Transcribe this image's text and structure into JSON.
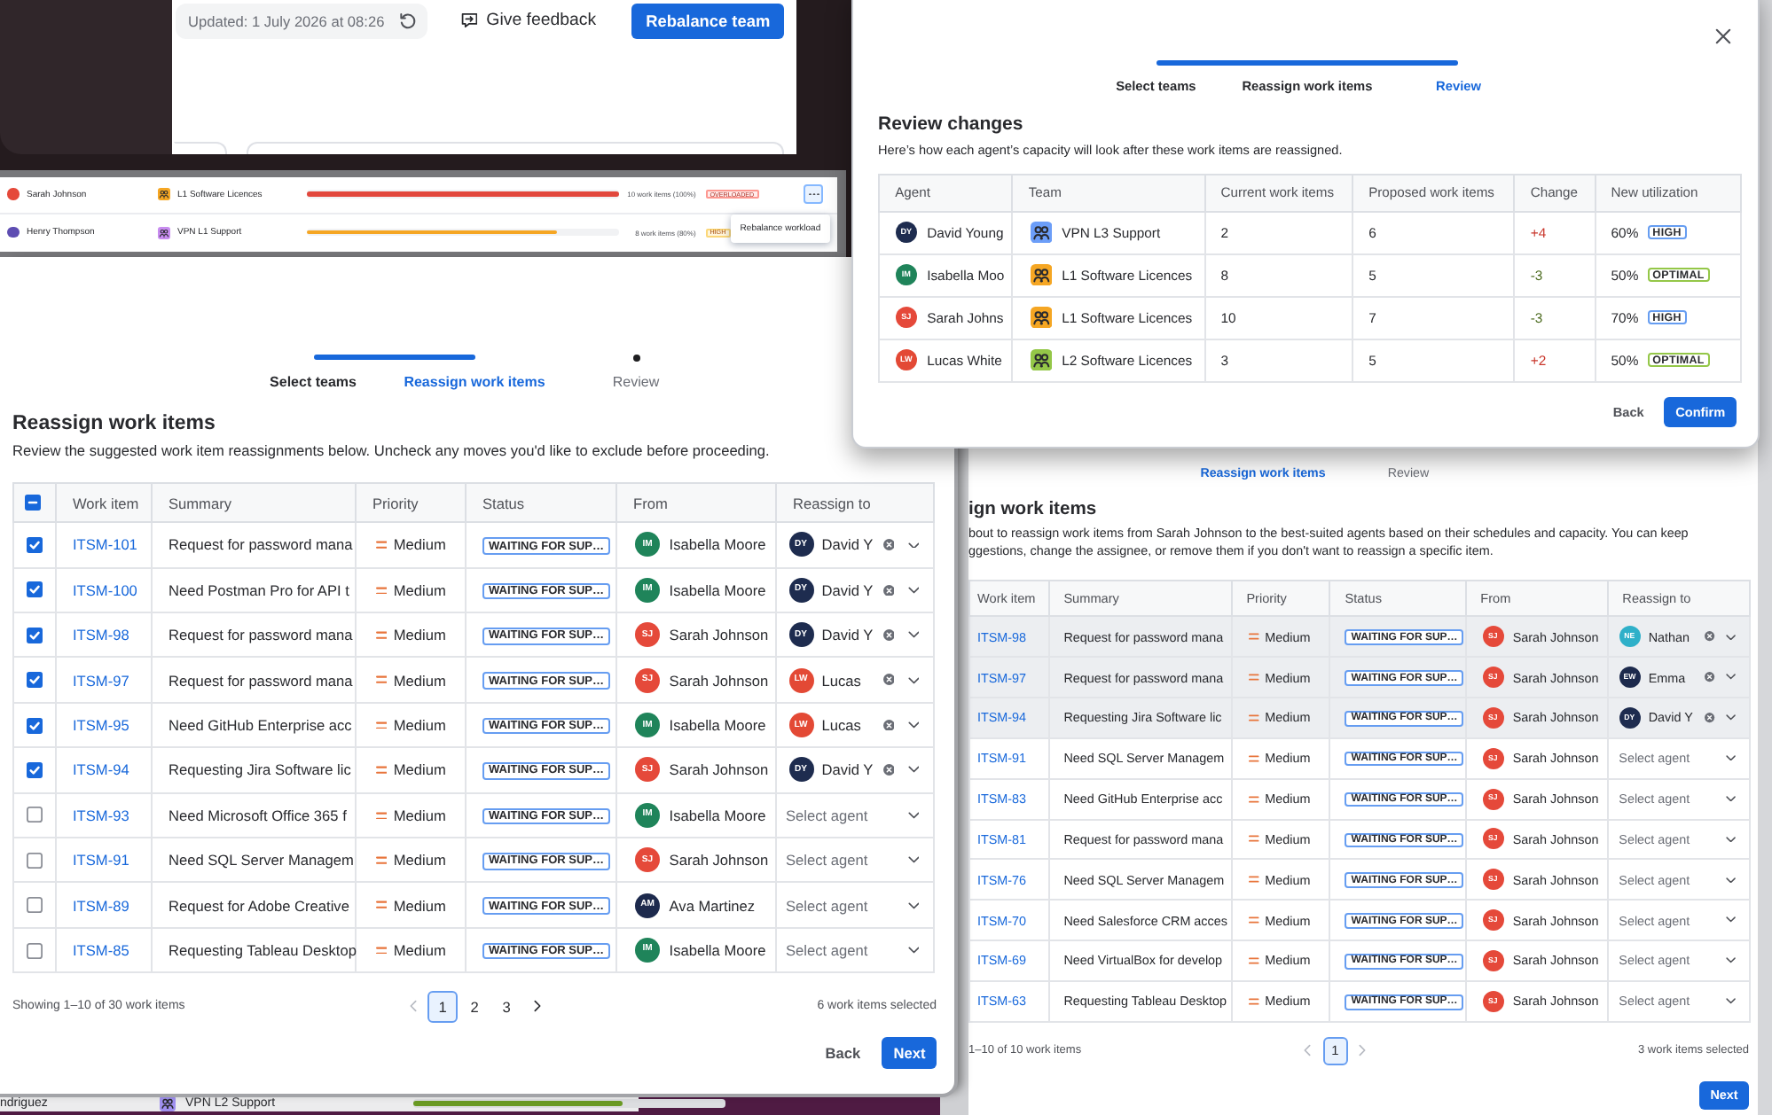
{
  "top_panel": {
    "updated": "Updated: 1 July 2026 at 08:26",
    "feedback": "Give feedback",
    "primary_button": "Rebalance team"
  },
  "review_dialog": {
    "steps": [
      {
        "label": "Select teams",
        "selected": false,
        "done": true
      },
      {
        "label": "Reassign work items",
        "selected": false,
        "done": true
      },
      {
        "label": "Review",
        "selected": true
      }
    ],
    "title": "Review changes",
    "description": "Here’s how each agent’s capacity will look after these work items are reassigned.",
    "table": {
      "columns": [
        "Agent",
        "Team",
        "Current work items",
        "Proposed work items",
        "Change",
        "New utilization"
      ],
      "rows": [
        {
          "agent": {
            "name": "David Young",
            "initials": "DY",
            "color": "#1e2c4f"
          },
          "team": {
            "name": "VPN L3 Support",
            "color": "#6c9ef8"
          },
          "current": "2",
          "proposed": "6",
          "change": {
            "value": "+4",
            "kind": "increase"
          },
          "utilization": {
            "value": "60%",
            "badge": "HIGH",
            "kind": "high"
          }
        },
        {
          "agent": {
            "name": "Isabella Moo",
            "initials": "IM",
            "color": "#1f845a"
          },
          "team": {
            "name": "L1 Software Licences",
            "color": "#f5a623"
          },
          "current": "8",
          "proposed": "5",
          "change": {
            "value": "-3",
            "kind": "decrease"
          },
          "utilization": {
            "value": "50%",
            "badge": "OPTIMAL",
            "kind": "optimal"
          }
        },
        {
          "agent": {
            "name": "Sarah Johns",
            "initials": "SJ",
            "color": "#e5493a"
          },
          "team": {
            "name": "L1 Software Licences",
            "color": "#f5a623"
          },
          "current": "10",
          "proposed": "7",
          "change": {
            "value": "-3",
            "kind": "decrease"
          },
          "utilization": {
            "value": "70%",
            "badge": "HIGH",
            "kind": "high"
          }
        },
        {
          "agent": {
            "name": "Lucas White",
            "initials": "LW",
            "color": "#e34935"
          },
          "team": {
            "name": "L2 Software Licences",
            "color": "#94c748"
          },
          "current": "3",
          "proposed": "5",
          "change": {
            "value": "+2",
            "kind": "increase"
          },
          "utilization": {
            "value": "50%",
            "badge": "OPTIMAL",
            "kind": "optimal"
          }
        }
      ]
    },
    "buttons": [
      {
        "label": "Back",
        "kind": "back"
      },
      {
        "label": "Confirm",
        "kind": "confirm"
      }
    ]
  },
  "workload_list": {
    "rows": [
      {
        "agent": {
          "name": "Sarah Johnson",
          "color": "#e5493a"
        },
        "team": {
          "name": "L1 Software Licences",
          "color": "#f5a623"
        },
        "level": 1,
        "reading": "10 work items (100%)",
        "badge": "OVERLOADED",
        "kind": "overloaded",
        "menu_open": true
      },
      {
        "agent": {
          "name": "Henry Thompson",
          "color": "#5e4db2"
        },
        "team": {
          "name": "VPN L1 Support",
          "color": "#c88cf0"
        },
        "level": 0.8,
        "reading": "8 work items (80%)",
        "badge": "HIGH",
        "kind": "high"
      }
    ],
    "menu": {
      "items": [
        "Rebalance workload"
      ]
    }
  },
  "reassign_panel": {
    "steps": [
      {
        "label": "Select teams",
        "selected": false,
        "done": true
      },
      {
        "label": "Reassign work items",
        "selected": true
      },
      {
        "label": "Review",
        "selected": false,
        "done": false
      }
    ],
    "title": "Reassign work items",
    "description": "Review the suggested work item reassignments below. Uncheck any moves you'd like to exclude before proceeding.",
    "table": {
      "header_checkbox": {
        "indeterminate": true
      },
      "columns": [
        "Work item",
        "Summary",
        "Priority",
        "Status",
        "From",
        "Reassign to"
      ],
      "rows": [
        {
          "checked": true,
          "key": "ITSM-101",
          "summary": "Request for password mana",
          "priority": "Medium",
          "status": "WAITING FOR SUP…",
          "from": {
            "name": "Isabella Moore",
            "initials": "IM",
            "color": "#1f845a"
          },
          "to": {
            "kind": "agent",
            "name": "David Y",
            "initials": "DY",
            "color": "#1e2c4f"
          }
        },
        {
          "checked": true,
          "key": "ITSM-100",
          "summary": "Need Postman Pro for API t",
          "priority": "Medium",
          "status": "WAITING FOR SUP…",
          "from": {
            "name": "Isabella Moore",
            "initials": "IM",
            "color": "#1f845a"
          },
          "to": {
            "kind": "agent",
            "name": "David Y",
            "initials": "DY",
            "color": "#1e2c4f"
          }
        },
        {
          "checked": true,
          "key": "ITSM-98",
          "summary": "Request for password mana",
          "priority": "Medium",
          "status": "WAITING FOR SUP…",
          "from": {
            "name": "Sarah Johnson",
            "initials": "SJ",
            "color": "#e5493a"
          },
          "to": {
            "kind": "agent",
            "name": "David Y",
            "initials": "DY",
            "color": "#1e2c4f"
          }
        },
        {
          "checked": true,
          "key": "ITSM-97",
          "summary": "Request for password mana",
          "priority": "Medium",
          "status": "WAITING FOR SUP…",
          "from": {
            "name": "Sarah Johnson",
            "initials": "SJ",
            "color": "#e5493a"
          },
          "to": {
            "kind": "agent",
            "name": "Lucas",
            "initials": "LW",
            "color": "#e34935"
          }
        },
        {
          "checked": true,
          "key": "ITSM-95",
          "summary": "Need GitHub Enterprise acc",
          "priority": "Medium",
          "status": "WAITING FOR SUP…",
          "from": {
            "name": "Isabella Moore",
            "initials": "IM",
            "color": "#1f845a"
          },
          "to": {
            "kind": "agent",
            "name": "Lucas",
            "initials": "LW",
            "color": "#e34935"
          }
        },
        {
          "checked": true,
          "key": "ITSM-94",
          "summary": "Requesting Jira Software lic",
          "priority": "Medium",
          "status": "WAITING FOR SUP…",
          "from": {
            "name": "Sarah Johnson",
            "initials": "SJ",
            "color": "#e5493a"
          },
          "to": {
            "kind": "agent",
            "name": "David Y",
            "initials": "DY",
            "color": "#1e2c4f"
          }
        },
        {
          "checked": false,
          "key": "ITSM-93",
          "summary": "Need Microsoft Office 365 f",
          "priority": "Medium",
          "status": "WAITING FOR SUP…",
          "from": {
            "name": "Isabella Moore",
            "initials": "IM",
            "color": "#1f845a"
          },
          "to": {
            "kind": "empty",
            "placeholder": "Select agent"
          }
        },
        {
          "checked": false,
          "key": "ITSM-91",
          "summary": "Need SQL Server Managem",
          "priority": "Medium",
          "status": "WAITING FOR SUP…",
          "from": {
            "name": "Sarah Johnson",
            "initials": "SJ",
            "color": "#e5493a"
          },
          "to": {
            "kind": "empty",
            "placeholder": "Select agent"
          }
        },
        {
          "checked": false,
          "key": "ITSM-89",
          "summary": "Request for Adobe Creative",
          "priority": "Medium",
          "status": "WAITING FOR SUP…",
          "from": {
            "name": "Ava Martinez",
            "initials": "AM",
            "color": "#1d2a4d"
          },
          "to": {
            "kind": "empty",
            "placeholder": "Select agent"
          }
        },
        {
          "checked": false,
          "key": "ITSM-85",
          "summary": "Requesting Tableau Desktop",
          "priority": "Medium",
          "status": "WAITING FOR SUP…",
          "from": {
            "name": "Isabella Moore",
            "initials": "IM",
            "color": "#1f845a"
          },
          "to": {
            "kind": "empty",
            "placeholder": "Select agent"
          }
        }
      ]
    },
    "pagination": {
      "summary": "Showing 1–10 of 30 work items",
      "prev": {
        "disabled": true
      },
      "pages": [
        {
          "label": "1",
          "selected": true
        },
        {
          "label": "2",
          "selected": false
        },
        {
          "label": "3",
          "selected": false
        }
      ],
      "next": {
        "disabled": false
      },
      "selection": "6 work items selected"
    },
    "buttons": [
      {
        "label": "Back",
        "kind": "back"
      },
      {
        "label": "Next",
        "kind": "next"
      }
    ]
  },
  "background_reassign_panel": {
    "steps": [
      {
        "label": "Reassign work items",
        "selected": true
      },
      {
        "label": "Review",
        "selected": false,
        "done": false
      }
    ],
    "title": "ign work items",
    "description_lines": [
      "bout to reassign work items from Sarah Johnson to the best-suited agents based on their schedules and capacity. You can keep",
      "ggestions, change the assignee, or remove them if you don't want to reassign a specific item."
    ],
    "table": {
      "columns": [
        "Work item",
        "Summary",
        "Priority",
        "Status",
        "From",
        "Reassign to"
      ],
      "rows": [
        {
          "selected": true,
          "key": "ITSM-98",
          "summary": "Request for password mana",
          "priority": "Medium",
          "status": "WAITING FOR SUP…",
          "from": {
            "name": "Sarah Johnson",
            "initials": "SJ",
            "color": "#e5493a"
          },
          "to": {
            "kind": "agent",
            "name": "Nathan",
            "initials": "NE",
            "color": "#2fb0c9"
          }
        },
        {
          "selected": true,
          "key": "ITSM-97",
          "summary": "Request for password mana",
          "priority": "Medium",
          "status": "WAITING FOR SUP…",
          "from": {
            "name": "Sarah Johnson",
            "initials": "SJ",
            "color": "#e5493a"
          },
          "to": {
            "kind": "agent",
            "name": "Emma",
            "initials": "EW",
            "color": "#1d2a4d"
          }
        },
        {
          "selected": true,
          "key": "ITSM-94",
          "summary": "Requesting Jira Software lic",
          "priority": "Medium",
          "status": "WAITING FOR SUP…",
          "from": {
            "name": "Sarah Johnson",
            "initials": "SJ",
            "color": "#e5493a"
          },
          "to": {
            "kind": "agent",
            "name": "David Y",
            "initials": "DY",
            "color": "#1e2c4f"
          }
        },
        {
          "selected": false,
          "key": "ITSM-91",
          "summary": "Need SQL Server Managem",
          "priority": "Medium",
          "status": "WAITING FOR SUP…",
          "from": {
            "name": "Sarah Johnson",
            "initials": "SJ",
            "color": "#e5493a"
          },
          "to": {
            "kind": "empty",
            "placeholder": "Select agent"
          }
        },
        {
          "selected": false,
          "key": "ITSM-83",
          "summary": "Need GitHub Enterprise acc",
          "priority": "Medium",
          "status": "WAITING FOR SUP…",
          "from": {
            "name": "Sarah Johnson",
            "initials": "SJ",
            "color": "#e5493a"
          },
          "to": {
            "kind": "empty",
            "placeholder": "Select agent"
          }
        },
        {
          "selected": false,
          "key": "ITSM-81",
          "summary": "Request for password mana",
          "priority": "Medium",
          "status": "WAITING FOR SUP…",
          "from": {
            "name": "Sarah Johnson",
            "initials": "SJ",
            "color": "#e5493a"
          },
          "to": {
            "kind": "empty",
            "placeholder": "Select agent"
          }
        },
        {
          "selected": false,
          "key": "ITSM-76",
          "summary": "Need SQL Server Managem",
          "priority": "Medium",
          "status": "WAITING FOR SUP…",
          "from": {
            "name": "Sarah Johnson",
            "initials": "SJ",
            "color": "#e5493a"
          },
          "to": {
            "kind": "empty",
            "placeholder": "Select agent"
          }
        },
        {
          "selected": false,
          "key": "ITSM-70",
          "summary": "Need Salesforce CRM acces",
          "priority": "Medium",
          "status": "WAITING FOR SUP…",
          "from": {
            "name": "Sarah Johnson",
            "initials": "SJ",
            "color": "#e5493a"
          },
          "to": {
            "kind": "empty",
            "placeholder": "Select agent"
          }
        },
        {
          "selected": false,
          "key": "ITSM-69",
          "summary": "Need VirtualBox for develop",
          "priority": "Medium",
          "status": "WAITING FOR SUP…",
          "from": {
            "name": "Sarah Johnson",
            "initials": "SJ",
            "color": "#e5493a"
          },
          "to": {
            "kind": "empty",
            "placeholder": "Select agent"
          }
        },
        {
          "selected": false,
          "key": "ITSM-63",
          "summary": "Requesting Tableau Desktop",
          "priority": "Medium",
          "status": "WAITING FOR SUP…",
          "from": {
            "name": "Sarah Johnson",
            "initials": "SJ",
            "color": "#e5493a"
          },
          "to": {
            "kind": "empty",
            "placeholder": "Select agent"
          }
        }
      ]
    },
    "pagination": {
      "summary": "1–10 of 10 work items",
      "prev": {
        "disabled": true
      },
      "pages": [
        {
          "label": "1",
          "selected": true
        }
      ],
      "next": {
        "disabled": true
      },
      "selection": "3 work items selected"
    },
    "buttons": [
      {
        "label": "Next",
        "kind": "next"
      }
    ]
  },
  "background_list": {
    "rows": [
      {
        "agent": "ndriguez",
        "team": {
          "name": "VPN L2 Support",
          "color": "#9f8fef"
        },
        "level": 0.67,
        "kind": "optimal"
      }
    ]
  }
}
